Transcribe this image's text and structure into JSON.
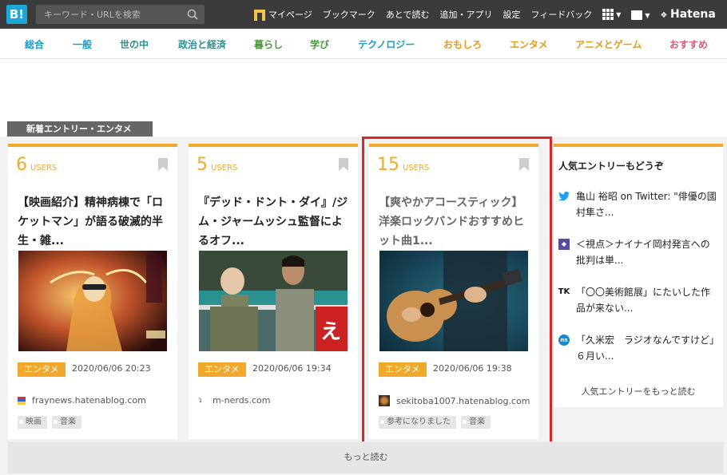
{
  "topbar": {
    "logo": "B!",
    "search_placeholder": "キーワード・URLを検索",
    "nav": {
      "mypage": "マイページ",
      "bookmark": "ブックマーク",
      "read_later": "あとで読む",
      "add_app": "追加・アプリ",
      "settings": "設定",
      "feedback": "フィードバック",
      "brand": "Hatena"
    }
  },
  "categories": [
    {
      "label": "総合",
      "color": "#1a9ac9"
    },
    {
      "label": "一般",
      "color": "#1a9ac9"
    },
    {
      "label": "世の中",
      "color": "#2f8f8f"
    },
    {
      "label": "政治と経済",
      "color": "#2f8f8f"
    },
    {
      "label": "暮らし",
      "color": "#4a9a3a"
    },
    {
      "label": "学び",
      "color": "#4a9a3a"
    },
    {
      "label": "テクノロジー",
      "color": "#1a9ac9"
    },
    {
      "label": "おもしろ",
      "color": "#e39c18"
    },
    {
      "label": "エンタメ",
      "color": "#e39c18"
    },
    {
      "label": "アニメとゲーム",
      "color": "#e39c18"
    },
    {
      "label": "おすすめ",
      "color": "#d95a75"
    }
  ],
  "section_label": "新着エントリー・エンタメ",
  "cards": [
    {
      "users": "6",
      "users_label": "USERS",
      "title": "【映画紹介】精神病棟で「ロケットマン」が語る破滅的半生・雑...",
      "category": "エンタメ",
      "date": "2020/06/06 20:23",
      "site": "fraynews.hatenablog.com",
      "tags": [
        "映画",
        "音楽"
      ]
    },
    {
      "users": "5",
      "users_label": "USERS",
      "title": "『デッド・ドント・ダイ』/ジム・ジャームッシュ監督によるオフ...",
      "category": "エンタメ",
      "date": "2020/06/06 19:34",
      "site": "m-nerds.com",
      "tags": []
    },
    {
      "users": "15",
      "users_label": "USERS",
      "title": "【爽やかアコースティック】洋楽ロックバンドおすすめヒット曲1...",
      "category": "エンタメ",
      "date": "2020/06/06 19:38",
      "site": "sekitoba1007.hatenablog.com",
      "tags": [
        "参考になりました",
        "音楽"
      ]
    }
  ],
  "sidebar": {
    "title": "人気エントリーもどうぞ",
    "items": [
      {
        "icon": "twitter-icon",
        "text": "亀山 裕昭 on Twitter: \"俳優の國村隼さ..."
      },
      {
        "icon": "shiten-icon",
        "text": "＜視点＞ナイナイ岡村発言への批判は単..."
      },
      {
        "icon": "tk-icon",
        "text": "「〇〇美術館展」にたいした作品が来ない..."
      },
      {
        "icon": "ns-icon",
        "text": "「久米宏　ラジオなんですけど」６月い..."
      }
    ],
    "more": "人気エントリーをもっと読む"
  },
  "more_button": "もっと読む"
}
